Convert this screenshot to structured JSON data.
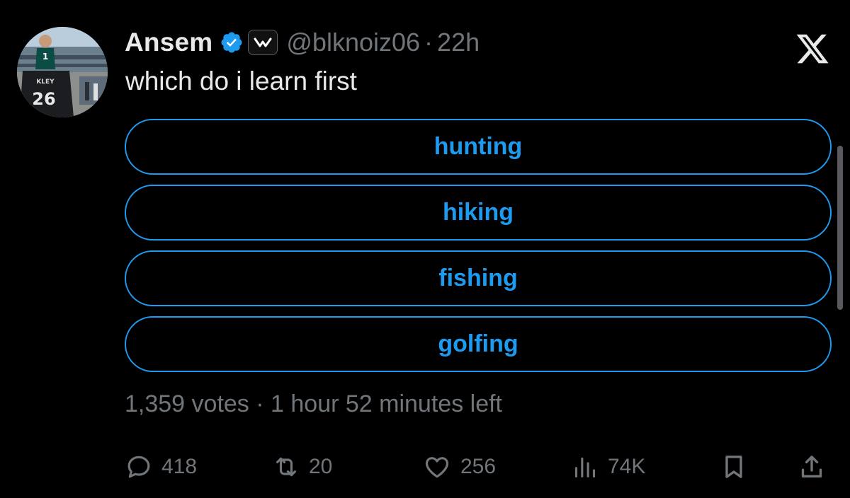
{
  "tweet": {
    "author_name": "Ansem",
    "handle": "@blknoiz06",
    "separator": "·",
    "time": "22h",
    "text": "which do i learn first"
  },
  "avatar": {
    "jersey_number": "26",
    "jersey_name": "BARKLEY"
  },
  "poll": {
    "options": [
      {
        "label": "hunting"
      },
      {
        "label": "hiking"
      },
      {
        "label": "fishing"
      },
      {
        "label": "golfing"
      }
    ],
    "votes": "1,359 votes",
    "separator": "·",
    "time_left": "1 hour 52 minutes left"
  },
  "actions": {
    "replies": "418",
    "reposts": "20",
    "likes": "256",
    "views": "74K"
  },
  "colors": {
    "background": "#000000",
    "accent": "#1d9bf0",
    "primary_text": "#e7e9ea",
    "secondary_text": "#71767b"
  }
}
